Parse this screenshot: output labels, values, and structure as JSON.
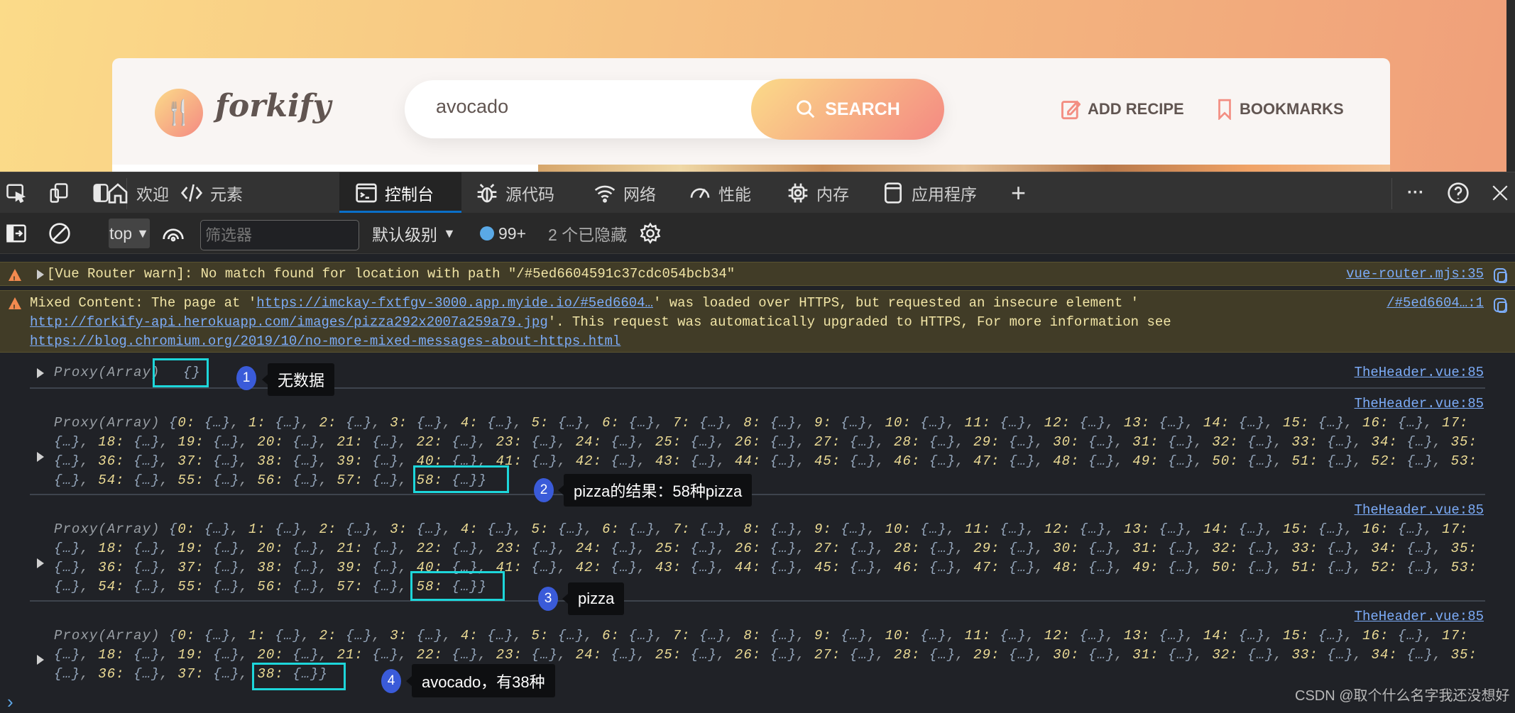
{
  "app": {
    "logo": "forkify",
    "search_value": "avocado",
    "search_button": "SEARCH",
    "add_recipe": "ADD RECIPE",
    "bookmarks": "BOOKMARKS"
  },
  "devtools": {
    "tabs": [
      {
        "label": "欢迎",
        "icon": "home-icon"
      },
      {
        "label": "元素",
        "icon": "code-icon"
      },
      {
        "label": "控制台",
        "icon": "console-icon",
        "active": true
      },
      {
        "label": "源代码",
        "icon": "bug-icon"
      },
      {
        "label": "网络",
        "icon": "wifi-icon"
      },
      {
        "label": "性能",
        "icon": "gauge-icon"
      },
      {
        "label": "内存",
        "icon": "chip-icon"
      },
      {
        "label": "应用程序",
        "icon": "app-icon"
      }
    ],
    "toolbar": {
      "context": "top",
      "filter_placeholder": "筛选器",
      "level": "默认级别",
      "message_count": "99+",
      "hidden": "2 个已隐藏"
    }
  },
  "console": {
    "warnings": [
      {
        "text_before": "[Vue Router warn]: No match found for location with path \"/#5ed6604591c37cdc054bcb34\"",
        "source": "vue-router.mjs:35"
      },
      {
        "line1_a": "Mixed Content: The page at '",
        "link1": "https://imckay-fxtfgv-3000.app.myide.io/#5ed6604…",
        "line1_b": "' was loaded over HTTPS, but requested an insecure element '",
        "link2": "http://forkify-api.herokuapp.com/images/pizza292x2007a259a79.jpg",
        "line2_b": "'. This request was automatically upgraded to HTTPS, For more information see",
        "link3": "https://blog.chromium.org/2019/10/no-more-mixed-messages-about-https.html",
        "source": "/#5ed6604…:1"
      }
    ],
    "logs": [
      {
        "summary": "Proxy(Array)",
        "count": 0,
        "source": "TheHeader.vue:85",
        "note": "无数据",
        "badge": "1"
      },
      {
        "summary": "Proxy(Array)",
        "count": 59,
        "source": "TheHeader.vue:85",
        "note": "pizza的结果：58种pizza",
        "badge": "2"
      },
      {
        "summary": "Proxy(Array)",
        "count": 59,
        "source": "TheHeader.vue:85",
        "note": "pizza",
        "badge": "3"
      },
      {
        "summary": "Proxy(Array)",
        "count": 39,
        "source": "TheHeader.vue:85",
        "note": "avocado，有38种",
        "badge": "4"
      }
    ],
    "collapsed_value": "{…}",
    "empty_value": "{}"
  },
  "watermark": "CSDN @取个什么名字我还没想好",
  "colors": {
    "accent": "#f48982",
    "highlight": "#1dd6da",
    "badge": "#3a5bd9",
    "warning_bg": "#413c27"
  }
}
